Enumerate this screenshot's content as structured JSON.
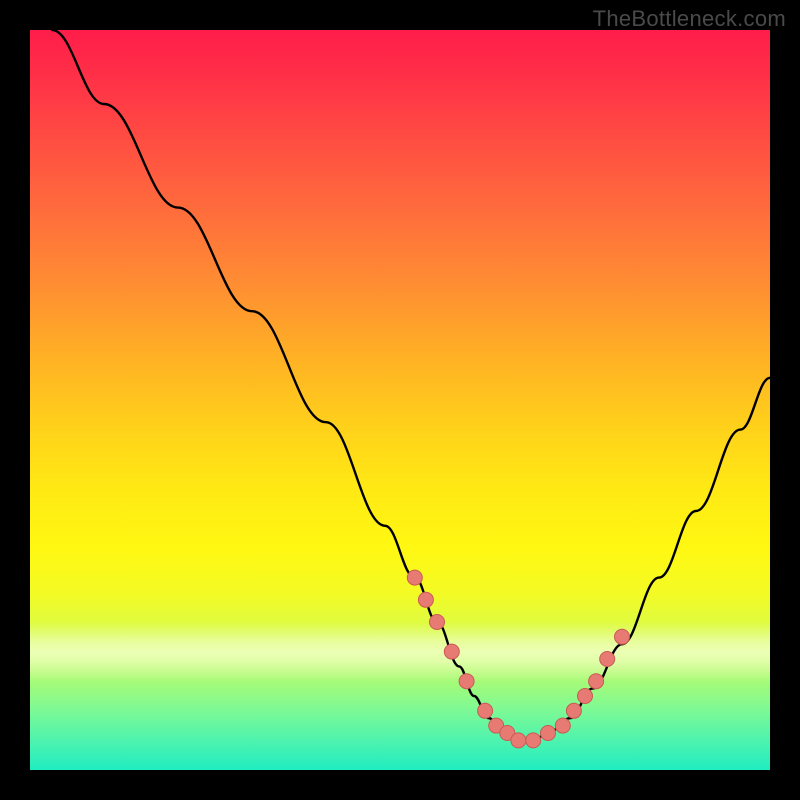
{
  "watermark": "TheBottleneck.com",
  "colors": {
    "background": "#000000",
    "curve": "#000000",
    "marker_fill": "#e77b74",
    "marker_stroke": "#c95a54",
    "gradient_top": "#ff1d4a",
    "gradient_bottom": "#20edc0"
  },
  "chart_data": {
    "type": "line",
    "title": "",
    "xlabel": "",
    "ylabel": "",
    "xlim": [
      0,
      100
    ],
    "ylim": [
      0,
      100
    ],
    "grid": false,
    "legend": false,
    "x": [
      3,
      10,
      20,
      30,
      40,
      48,
      52,
      55,
      58,
      60,
      62,
      64,
      66,
      68,
      70,
      73,
      76,
      80,
      85,
      90,
      96,
      100
    ],
    "y": [
      100,
      90,
      76,
      62,
      47,
      33,
      26,
      20,
      14,
      10,
      7,
      5,
      4,
      4,
      5,
      7,
      11,
      17,
      26,
      35,
      46,
      53
    ],
    "markers": {
      "x": [
        52,
        53.5,
        55,
        57,
        59,
        61.5,
        63,
        64.5,
        66,
        68,
        70,
        72,
        73.5,
        75,
        76.5,
        78,
        80
      ],
      "y": [
        26,
        23,
        20,
        16,
        12,
        8,
        6,
        5,
        4,
        4,
        5,
        6,
        8,
        10,
        12,
        15,
        18
      ]
    }
  }
}
